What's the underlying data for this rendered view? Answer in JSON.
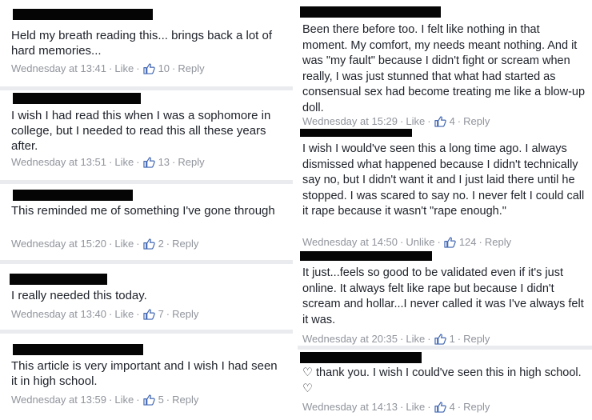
{
  "accent_color": "#4267b2",
  "icons": {
    "like": "thumbs-up-icon",
    "heart": "heart-icon"
  },
  "left_comments": [
    {
      "text": "Held my breath reading this... brings back a lot of hard memories...",
      "time": "Wednesday at 13:41",
      "like": "Like",
      "count": "10",
      "reply": "Reply"
    },
    {
      "text": "I wish I had read this when I was a sophomore in college, but I needed to read this all these years after.",
      "time": "Wednesday at 13:51",
      "like": "Like",
      "count": "13",
      "reply": "Reply"
    },
    {
      "text": "This reminded me of something I've gone through",
      "time": "Wednesday at 15:20",
      "like": "Like",
      "count": "2",
      "reply": "Reply"
    },
    {
      "text": "I really needed this today.",
      "time": "Wednesday at 13:40",
      "like": "Like",
      "count": "7",
      "reply": "Reply"
    },
    {
      "text": "This article is very important and I wish I had seen it in high school.",
      "time": "Wednesday at 13:59",
      "like": "Like",
      "count": "5",
      "reply": "Reply"
    }
  ],
  "right_comments": [
    {
      "text": "Been there before too. I felt like nothing in that moment. My comfort, my needs meant nothing. And it was \"my fault\" because I didn't fight or scream when really, I was just stunned that what had started as consensual sex had become treating me like a blow-up doll.",
      "time": "Wednesday at 15:29",
      "like": "Like",
      "count": "4",
      "reply": "Reply"
    },
    {
      "text": "I wish I would've seen this a long time ago. I always dismissed what happened because I didn't technically say no, but I didn't want it and I just laid there until he stopped. I was scared to say no. I never felt I could call it rape because it wasn't \"rape enough.\"",
      "time": "Wednesday at 14:50",
      "like": "Unlike",
      "count": "124",
      "reply": "Reply"
    },
    {
      "text": "It just...feels so good to be validated even if it's just online. It always felt like rape but because I didn't scream and hollar...I never called it was I've always felt it was.",
      "time": "Wednesday at 20:35",
      "like": "Like",
      "count": "1",
      "reply": "Reply"
    },
    {
      "text": "♡ thank you.  I wish I could've seen this in high school. ♡",
      "time": "Wednesday at 14:13",
      "like": "Like",
      "count": "4",
      "reply": "Reply"
    }
  ]
}
